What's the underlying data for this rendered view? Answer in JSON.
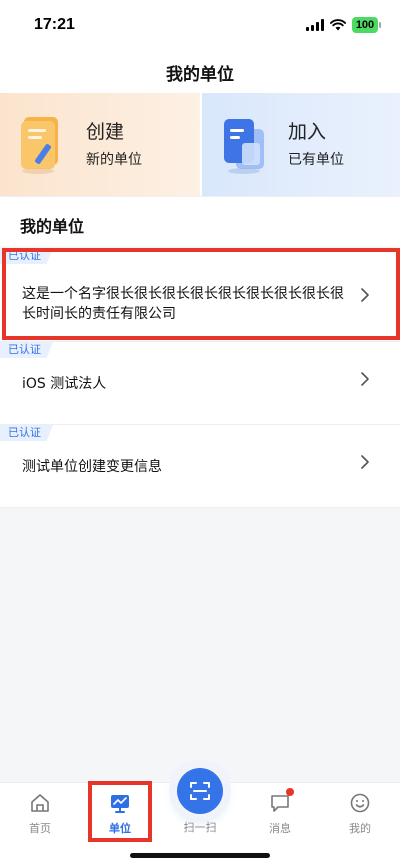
{
  "status_bar": {
    "time": "17:21",
    "battery": "100"
  },
  "nav": {
    "title": "我的单位"
  },
  "banners": [
    {
      "title": "创建",
      "subtitle": "新的单位",
      "icon": "document-pen-icon"
    },
    {
      "title": "加入",
      "subtitle": "已有单位",
      "icon": "documents-stack-icon"
    }
  ],
  "section": {
    "title": "我的单位"
  },
  "organizations": [
    {
      "tag": "已认证",
      "name": "这是一个名字很长很长很长很长很长很长很长很长很长时间长的责任有限公司"
    },
    {
      "tag": "已认证",
      "name": "iOS 测试法人"
    },
    {
      "tag": "已认证",
      "name": "测试单位创建变更信息"
    }
  ],
  "tabs": [
    {
      "label": "首页",
      "icon": "home-icon"
    },
    {
      "label": "单位",
      "icon": "unit-chart-icon"
    },
    {
      "label": "扫一扫",
      "icon": "scan-icon"
    },
    {
      "label": "消息",
      "icon": "message-icon"
    },
    {
      "label": "我的",
      "icon": "smiley-icon"
    }
  ],
  "colors": {
    "accent": "#2f6fe4",
    "highlight": "#e8352a",
    "tag_text": "#3471e6",
    "tag_bg": "#e8f0fe"
  }
}
